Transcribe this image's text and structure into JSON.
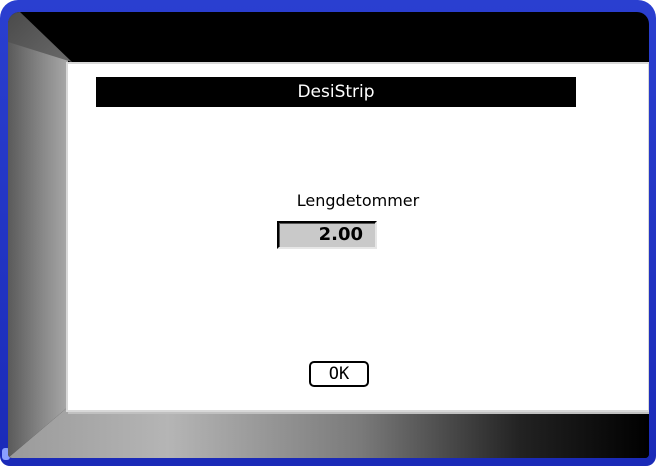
{
  "dialog": {
    "title": "DesiStrip",
    "field_label": "Lengdetommer",
    "field_value": "2.00",
    "ok_label": "OK"
  },
  "colors": {
    "bezel": "#1a2ab8",
    "title_bar": "#000000",
    "value_box": "#c9c9c9"
  }
}
